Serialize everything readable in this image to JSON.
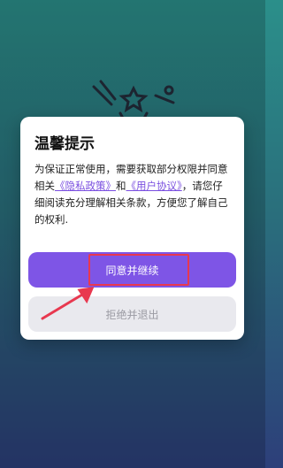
{
  "dialog": {
    "title": "温馨提示",
    "text_before": "为保证正常使用，需要获取部分权限并同意相关",
    "privacy_link": "《隐私政策》",
    "text_and": "和",
    "user_agreement_link": "《用户协议》",
    "text_after": "，请您仔细阅读充分理解相关条款，方便您了解自己的权利."
  },
  "buttons": {
    "agree_label": "同意并继续",
    "refuse_label": "拒绝并退出"
  },
  "colors": {
    "primary": "#7e55e6",
    "link": "#7a4fe0",
    "secondary_button_bg": "#e9e9ee",
    "highlight_annotation": "#e8384f"
  },
  "icons": {
    "decoration": "fireworks-icon",
    "annotation_arrow": "arrow-annotation"
  }
}
